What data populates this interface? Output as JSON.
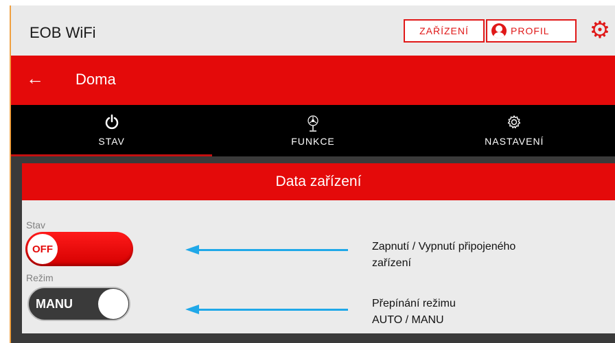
{
  "app": {
    "title": "EOB WiFi"
  },
  "topbar": {
    "devices_label": "ZAŘÍZENÍ",
    "profile_label": "PROFIL",
    "settings_icon": "gear-icon",
    "accent_color": "#e01818"
  },
  "header": {
    "title": "Doma",
    "back_icon": "arrow-left-icon",
    "color": "#e40a0a"
  },
  "tabs": [
    {
      "label": "STAV",
      "icon": "power-icon",
      "active": true
    },
    {
      "label": "FUNKCE",
      "icon": "fan-icon",
      "active": false
    },
    {
      "label": "NASTAVENÍ",
      "icon": "gear-outline-icon",
      "active": false
    }
  ],
  "card": {
    "title": "Data zařízení",
    "state": {
      "label": "Stav",
      "value": "OFF"
    },
    "mode": {
      "label": "Režim",
      "value": "MANU"
    }
  },
  "annotations": {
    "state_desc_line1": "Zapnutí / Vypnutí připojeného",
    "state_desc_line2": "zařízení",
    "mode_desc_line1": "Přepínání režimu",
    "mode_desc_line2": "AUTO / MANU",
    "arrow_color": "#20a8e8"
  }
}
